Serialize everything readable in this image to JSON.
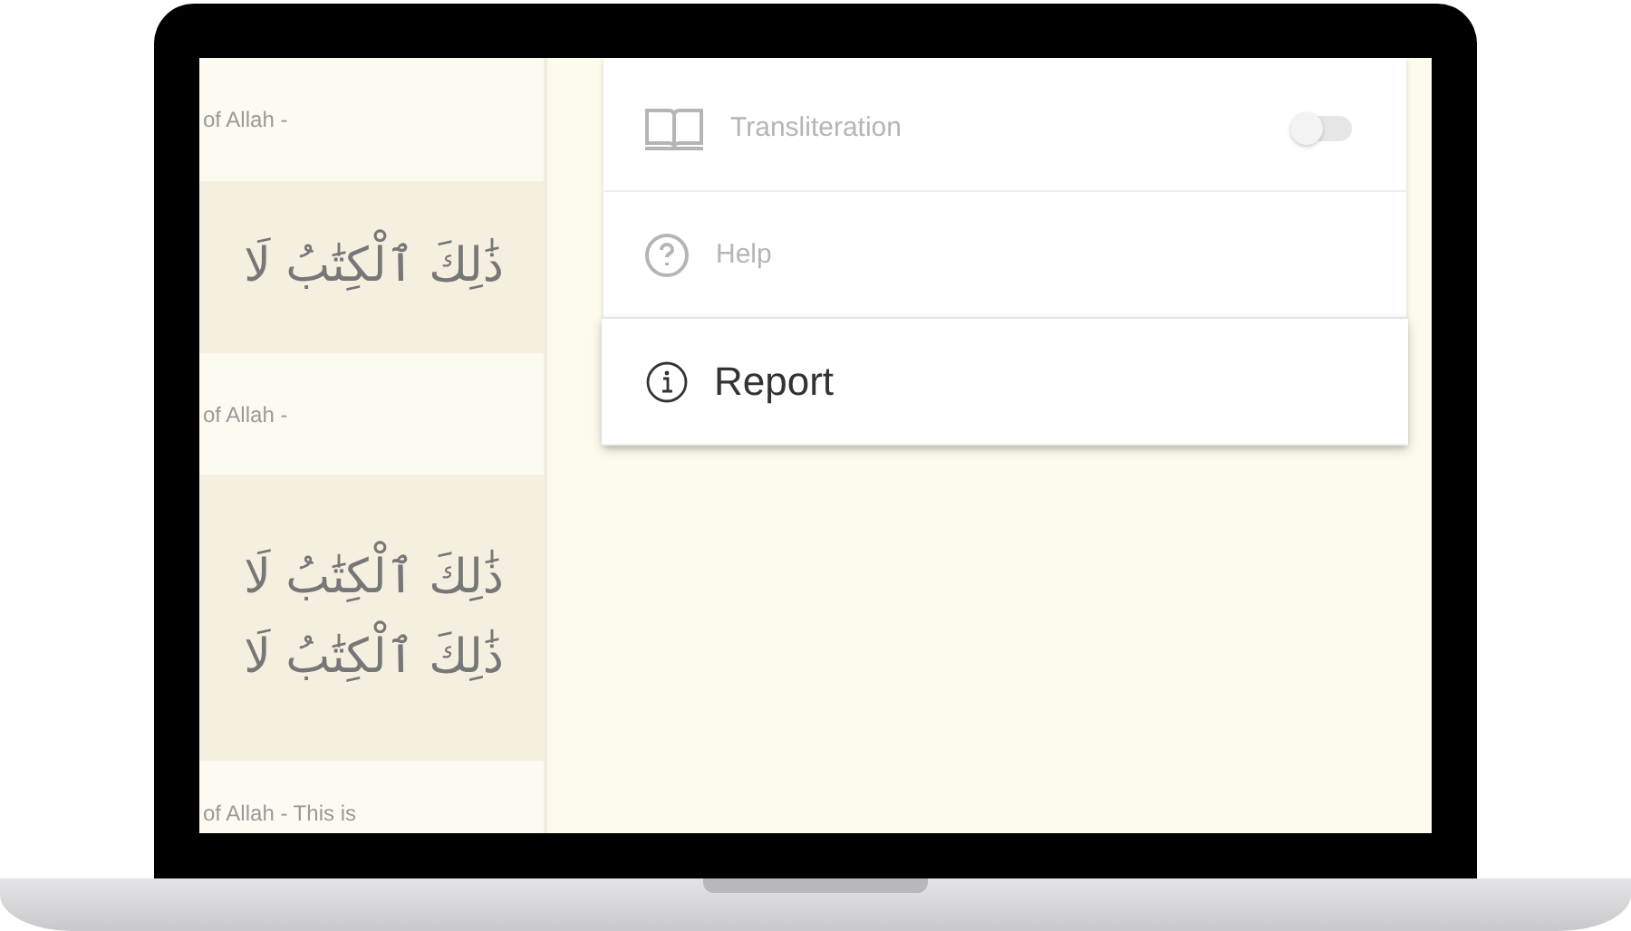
{
  "left_column": {
    "rows": [
      {
        "kind": "translation",
        "lines": [
          "of Allah -"
        ]
      },
      {
        "kind": "arabic",
        "lines": [
          "ذَٰلِكَ ٱلْكِتَٰبُ لَا"
        ]
      },
      {
        "kind": "translation",
        "lines": [
          "of Allah -"
        ]
      },
      {
        "kind": "arabic",
        "lines": [
          "ذَٰلِكَ ٱلْكِتَٰبُ لَا",
          "ذَٰلِكَ ٱلْكِتَٰبُ لَا"
        ]
      },
      {
        "kind": "translation",
        "lines": [
          "of Allah - This is"
        ]
      }
    ]
  },
  "menu": {
    "items": [
      {
        "kind": "toggle",
        "label": "Transliteration",
        "on": false,
        "highlighted": false
      },
      {
        "kind": "plain",
        "label": "Help",
        "highlighted": false
      },
      {
        "kind": "plain",
        "label": "Report",
        "highlighted": true
      }
    ]
  }
}
